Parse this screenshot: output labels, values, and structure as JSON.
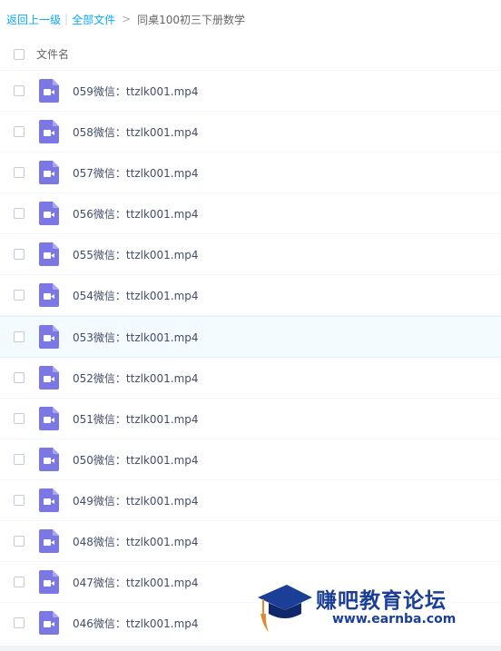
{
  "breadcrumb": {
    "back": "返回上一级",
    "separator": "|",
    "root": "全部文件",
    "arrow": ">",
    "current": "同桌100初三下册数学"
  },
  "header": {
    "name_label": "文件名"
  },
  "files": [
    {
      "name": "059微信：ttzlk001.mp4"
    },
    {
      "name": "058微信：ttzlk001.mp4"
    },
    {
      "name": "057微信：ttzlk001.mp4"
    },
    {
      "name": "056微信：ttzlk001.mp4"
    },
    {
      "name": "055微信：ttzlk001.mp4"
    },
    {
      "name": "054微信：ttzlk001.mp4"
    },
    {
      "name": "053微信：ttzlk001.mp4"
    },
    {
      "name": "052微信：ttzlk001.mp4"
    },
    {
      "name": "051微信：ttzlk001.mp4"
    },
    {
      "name": "050微信：ttzlk001.mp4"
    },
    {
      "name": "049微信：ttzlk001.mp4"
    },
    {
      "name": "048微信：ttzlk001.mp4"
    },
    {
      "name": "047微信：ttzlk001.mp4"
    },
    {
      "name": "046微信：ttzlk001.mp4"
    }
  ],
  "highlighted_row": 6,
  "watermark": {
    "title": "赚吧教育论坛",
    "url": "www.earnba.com"
  },
  "colors": {
    "link": "#09aaff",
    "video_icon": "#7b78e5",
    "watermark": "#1b3f96"
  }
}
